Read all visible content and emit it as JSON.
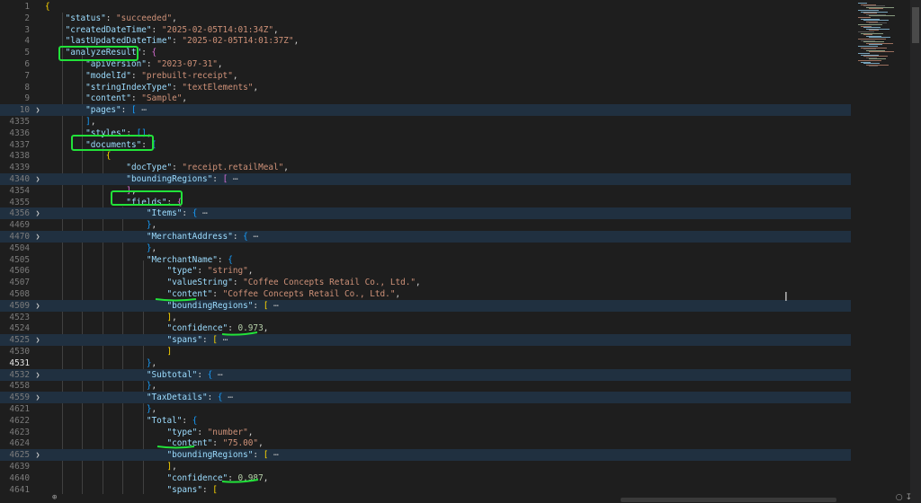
{
  "lines": [
    {
      "ln": "1",
      "t": [
        [
          "b1",
          "{"
        ]
      ]
    },
    {
      "ln": "2",
      "t": [
        [
          "k",
          "    \"status\""
        ],
        [
          "p",
          ": "
        ],
        [
          "s",
          "\"succeeded\""
        ],
        [
          "p",
          ","
        ]
      ]
    },
    {
      "ln": "3",
      "t": [
        [
          "k",
          "    \"createdDateTime\""
        ],
        [
          "p",
          ": "
        ],
        [
          "s",
          "\"2025-02-05T14:01:34Z\""
        ],
        [
          "p",
          ","
        ]
      ]
    },
    {
      "ln": "4",
      "t": [
        [
          "k",
          "    \"lastUpdatedDateTime\""
        ],
        [
          "p",
          ": "
        ],
        [
          "s",
          "\"2025-02-05T14:01:37Z\""
        ],
        [
          "p",
          ","
        ]
      ]
    },
    {
      "ln": "5",
      "t": [
        [
          "k",
          "    \"analyzeResult\""
        ],
        [
          "p",
          ": "
        ],
        [
          "b2",
          "{"
        ]
      ]
    },
    {
      "ln": "6",
      "t": [
        [
          "k",
          "        \"apiVersion\""
        ],
        [
          "p",
          ": "
        ],
        [
          "s",
          "\"2023-07-31\""
        ],
        [
          "p",
          ","
        ]
      ]
    },
    {
      "ln": "7",
      "t": [
        [
          "k",
          "        \"modelId\""
        ],
        [
          "p",
          ": "
        ],
        [
          "s",
          "\"prebuilt-receipt\""
        ],
        [
          "p",
          ","
        ]
      ]
    },
    {
      "ln": "8",
      "t": [
        [
          "k",
          "        \"stringIndexType\""
        ],
        [
          "p",
          ": "
        ],
        [
          "s",
          "\"textElements\""
        ],
        [
          "p",
          ","
        ]
      ]
    },
    {
      "ln": "9",
      "t": [
        [
          "k",
          "        \"content\""
        ],
        [
          "p",
          ": "
        ],
        [
          "s",
          "\"Sample\""
        ],
        [
          "p",
          ","
        ]
      ]
    },
    {
      "ln": "10",
      "fold": true,
      "t": [
        [
          "k",
          "        \"pages\""
        ],
        [
          "p",
          ": "
        ],
        [
          "b3",
          "["
        ],
        [
          "fold",
          " ⋯"
        ]
      ]
    },
    {
      "ln": "4335",
      "t": [
        [
          "b3",
          "        ]"
        ],
        [
          "p",
          ","
        ]
      ]
    },
    {
      "ln": "4336",
      "t": [
        [
          "k",
          "        \"styles\""
        ],
        [
          "p",
          ": "
        ],
        [
          "b3",
          "[]"
        ],
        [
          "p",
          ","
        ]
      ]
    },
    {
      "ln": "4337",
      "t": [
        [
          "k",
          "        \"documents\""
        ],
        [
          "p",
          ": "
        ],
        [
          "b3",
          "["
        ]
      ]
    },
    {
      "ln": "4338",
      "t": [
        [
          "b1",
          "            {"
        ]
      ]
    },
    {
      "ln": "4339",
      "t": [
        [
          "k",
          "                \"docType\""
        ],
        [
          "p",
          ": "
        ],
        [
          "s",
          "\"receipt.retailMeal\""
        ],
        [
          "p",
          ","
        ]
      ]
    },
    {
      "ln": "4340",
      "fold": true,
      "t": [
        [
          "k",
          "                \"boundingRegions\""
        ],
        [
          "p",
          ": "
        ],
        [
          "b2",
          "["
        ],
        [
          "fold",
          " ⋯"
        ]
      ]
    },
    {
      "ln": "4354",
      "t": [
        [
          "b2",
          "                ]"
        ],
        [
          "p",
          ","
        ]
      ]
    },
    {
      "ln": "4355",
      "t": [
        [
          "k",
          "                \"fields\""
        ],
        [
          "p",
          ": "
        ],
        [
          "b2",
          "{"
        ]
      ]
    },
    {
      "ln": "4356",
      "fold": true,
      "t": [
        [
          "k",
          "                    \"Items\""
        ],
        [
          "p",
          ": "
        ],
        [
          "b3",
          "{"
        ],
        [
          "fold",
          " ⋯"
        ]
      ]
    },
    {
      "ln": "4469",
      "t": [
        [
          "b3",
          "                    }"
        ],
        [
          "p",
          ","
        ]
      ]
    },
    {
      "ln": "4470",
      "fold": true,
      "t": [
        [
          "k",
          "                    \"MerchantAddress\""
        ],
        [
          "p",
          ": "
        ],
        [
          "b3",
          "{"
        ],
        [
          "fold",
          " ⋯"
        ]
      ]
    },
    {
      "ln": "4504",
      "t": [
        [
          "b3",
          "                    }"
        ],
        [
          "p",
          ","
        ]
      ]
    },
    {
      "ln": "4505",
      "t": [
        [
          "k",
          "                    \"MerchantName\""
        ],
        [
          "p",
          ": "
        ],
        [
          "b3",
          "{"
        ]
      ]
    },
    {
      "ln": "4506",
      "t": [
        [
          "k",
          "                        \"type\""
        ],
        [
          "p",
          ": "
        ],
        [
          "s",
          "\"string\""
        ],
        [
          "p",
          ","
        ]
      ]
    },
    {
      "ln": "4507",
      "t": [
        [
          "k",
          "                        \"valueString\""
        ],
        [
          "p",
          ": "
        ],
        [
          "s",
          "\"Coffee Concepts Retail Co., Ltd.\""
        ],
        [
          "p",
          ","
        ]
      ]
    },
    {
      "ln": "4508",
      "t": [
        [
          "k",
          "                        \"content\""
        ],
        [
          "p",
          ": "
        ],
        [
          "s",
          "\"Coffee Concepts Retail Co., Ltd.\""
        ],
        [
          "p",
          ","
        ]
      ]
    },
    {
      "ln": "4509",
      "fold": true,
      "t": [
        [
          "k",
          "                        \"boundingRegions\""
        ],
        [
          "p",
          ": "
        ],
        [
          "b1",
          "["
        ],
        [
          "fold",
          " ⋯"
        ]
      ]
    },
    {
      "ln": "4523",
      "t": [
        [
          "b1",
          "                        ]"
        ],
        [
          "p",
          ","
        ]
      ]
    },
    {
      "ln": "4524",
      "t": [
        [
          "k",
          "                        \"confidence\""
        ],
        [
          "p",
          ": "
        ],
        [
          "n",
          "0.973"
        ],
        [
          "p",
          ","
        ]
      ]
    },
    {
      "ln": "4525",
      "fold": true,
      "t": [
        [
          "k",
          "                        \"spans\""
        ],
        [
          "p",
          ": "
        ],
        [
          "b1",
          "["
        ],
        [
          "fold",
          " ⋯"
        ]
      ]
    },
    {
      "ln": "4530",
      "t": [
        [
          "b1",
          "                        ]"
        ]
      ]
    },
    {
      "ln": "4531",
      "active": true,
      "t": [
        [
          "b3",
          "                    }"
        ],
        [
          "p",
          ","
        ]
      ]
    },
    {
      "ln": "4532",
      "fold": true,
      "t": [
        [
          "k",
          "                    \"Subtotal\""
        ],
        [
          "p",
          ": "
        ],
        [
          "b3",
          "{"
        ],
        [
          "fold",
          " ⋯"
        ]
      ]
    },
    {
      "ln": "4558",
      "t": [
        [
          "b3",
          "                    }"
        ],
        [
          "p",
          ","
        ]
      ]
    },
    {
      "ln": "4559",
      "fold": true,
      "t": [
        [
          "k",
          "                    \"TaxDetails\""
        ],
        [
          "p",
          ": "
        ],
        [
          "b3",
          "{"
        ],
        [
          "fold",
          " ⋯"
        ]
      ]
    },
    {
      "ln": "4621",
      "t": [
        [
          "b3",
          "                    }"
        ],
        [
          "p",
          ","
        ]
      ]
    },
    {
      "ln": "4622",
      "t": [
        [
          "k",
          "                    \"Total\""
        ],
        [
          "p",
          ": "
        ],
        [
          "b3",
          "{"
        ]
      ]
    },
    {
      "ln": "4623",
      "t": [
        [
          "k",
          "                        \"type\""
        ],
        [
          "p",
          ": "
        ],
        [
          "s",
          "\"number\""
        ],
        [
          "p",
          ","
        ]
      ]
    },
    {
      "ln": "4624",
      "t": [
        [
          "k",
          "                        \"content\""
        ],
        [
          "p",
          ": "
        ],
        [
          "s",
          "\"75.00\""
        ],
        [
          "p",
          ","
        ]
      ]
    },
    {
      "ln": "4625",
      "fold": true,
      "t": [
        [
          "k",
          "                        \"boundingRegions\""
        ],
        [
          "p",
          ": "
        ],
        [
          "b1",
          "["
        ],
        [
          "fold",
          " ⋯"
        ]
      ]
    },
    {
      "ln": "4639",
      "t": [
        [
          "b1",
          "                        ]"
        ],
        [
          "p",
          ","
        ]
      ]
    },
    {
      "ln": "4640",
      "t": [
        [
          "k",
          "                        \"confidence\""
        ],
        [
          "p",
          ": "
        ],
        [
          "n",
          "0.987"
        ],
        [
          "p",
          ","
        ]
      ]
    },
    {
      "ln": "4641",
      "t": [
        [
          "k",
          "                        \"spans\""
        ],
        [
          "p",
          ": "
        ],
        [
          "b1",
          "["
        ]
      ]
    }
  ],
  "highlights": [
    "analyzeResult-box",
    "documents-box",
    "fields-box"
  ],
  "underlines": [
    "merchant-content",
    "merchant-confidence",
    "total-content",
    "total-confidence"
  ],
  "colors": {
    "highlight": "#22e23a",
    "background": "#1e1e1e",
    "key": "#9cdcfe",
    "string": "#ce9178",
    "number": "#b5cea8"
  }
}
